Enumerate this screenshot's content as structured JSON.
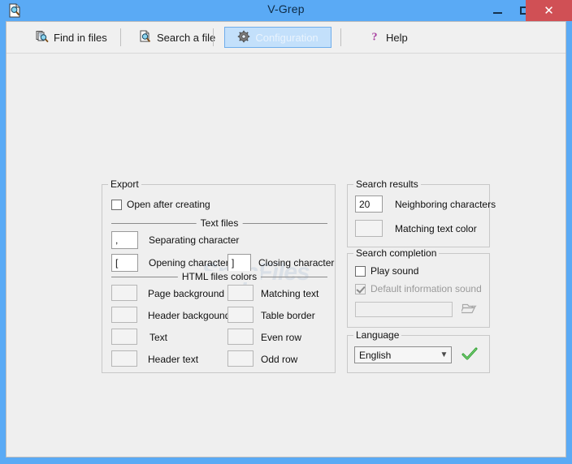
{
  "window": {
    "title": "V-Grep",
    "app_icon": "document-search-icon",
    "minimize_label": "Minimize",
    "maximize_label": "Maximize",
    "close_label": "Close",
    "close_glyph": "✕",
    "titlebar_color": "#5aaaf5",
    "close_color": "#d05055",
    "client_bg": "#efefef"
  },
  "toolbar": {
    "buttons": [
      {
        "id": "find-in-files",
        "label": "Find in files",
        "icon": "find-in-files-icon",
        "active": false
      },
      {
        "id": "search-a-file",
        "label": "Search a file",
        "icon": "search-file-icon",
        "active": false
      },
      {
        "id": "configuration",
        "label": "Configuration",
        "icon": "gear-icon",
        "active": true
      },
      {
        "id": "help",
        "label": "Help",
        "icon": "question-mark-icon",
        "active": false
      }
    ]
  },
  "watermark": {
    "text": "SnapFiles"
  },
  "export": {
    "title": "Export",
    "open_after_creating": {
      "label": "Open after creating",
      "checked": false
    },
    "text_files": {
      "caption": "Text files",
      "separating": {
        "label": "Separating character",
        "value": ","
      },
      "opening": {
        "label": "Opening character",
        "value": "["
      },
      "closing": {
        "label": "Closing character",
        "value": "]"
      }
    },
    "html_colors": {
      "caption": "HTML files colors",
      "left": [
        {
          "label": "Page background",
          "color": ""
        },
        {
          "label": "Header backgound",
          "color": ""
        },
        {
          "label": "Text",
          "color": ""
        },
        {
          "label": "Header text",
          "color": ""
        }
      ],
      "right": [
        {
          "label": "Matching text",
          "color": ""
        },
        {
          "label": "Table border",
          "color": ""
        },
        {
          "label": "Even row",
          "color": ""
        },
        {
          "label": "Odd row",
          "color": ""
        }
      ]
    }
  },
  "search_results": {
    "title": "Search results",
    "neighboring": {
      "label": "Neighboring characters",
      "value": "20"
    },
    "matching_color": {
      "label": "Matching text color",
      "color": ""
    }
  },
  "search_completion": {
    "title": "Search completion",
    "play_sound": {
      "label": "Play sound",
      "checked": false,
      "enabled": true
    },
    "default_sound": {
      "label": "Default information sound",
      "checked": true,
      "enabled": false
    },
    "sound_path": {
      "value": "",
      "enabled": false
    },
    "browse_icon": "open-folder-icon"
  },
  "language": {
    "title": "Language",
    "selected": "English",
    "arrow": "▼",
    "confirm_icon": "green-check-icon"
  }
}
